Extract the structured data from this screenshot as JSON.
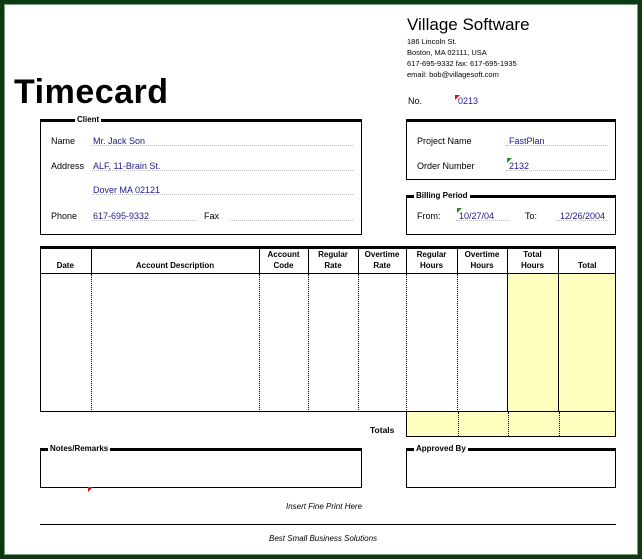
{
  "company": {
    "name": "Village Software",
    "address1": "186 Lincoln St.",
    "address2": "Boston, MA 02111, USA",
    "phone_fax": "617-695-9332 fax: 617-695-1935",
    "email": "email: bob@villagesoft.com"
  },
  "title": "Timecard",
  "number": {
    "label": "No.",
    "value": "0213"
  },
  "client": {
    "section_label": "Client",
    "name_label": "Name",
    "name_value": "Mr. Jack Son",
    "address_label": "Address",
    "address_line1": "ALF, 11-Brain St.",
    "address_line2": "Dover MA 02121",
    "phone_label": "Phone",
    "phone_value": "617-695-9332",
    "fax_label": "Fax",
    "fax_value": ""
  },
  "project": {
    "project_name_label": "Project Name",
    "project_name_value": "FastPlan",
    "order_number_label": "Order Number",
    "order_number_value": "2132"
  },
  "billing": {
    "section_label": "Billing Period",
    "from_label": "From:",
    "from_value": "10/27/04",
    "to_label": "To:",
    "to_value": "12/26/2004"
  },
  "table": {
    "columns": [
      {
        "line1": "",
        "line2": "Date"
      },
      {
        "line1": "",
        "line2": "Account Description"
      },
      {
        "line1": "Account",
        "line2": "Code"
      },
      {
        "line1": "Regular",
        "line2": "Rate"
      },
      {
        "line1": "Overtime",
        "line2": "Rate"
      },
      {
        "line1": "Regular",
        "line2": "Hours"
      },
      {
        "line1": "Overtime",
        "line2": "Hours"
      },
      {
        "line1": "Total",
        "line2": "Hours"
      },
      {
        "line1": "",
        "line2": "Total"
      }
    ],
    "totals_label": "Totals"
  },
  "notes": {
    "label": "Notes/Remarks",
    "value": ""
  },
  "approved": {
    "label": "Approved By",
    "value": ""
  },
  "fine_print": "Insert Fine Print Here",
  "footer": "Best Small Business Solutions",
  "colors": {
    "frame": "#0b3a12",
    "field_text": "#1b1b8a",
    "highlight": "#ffffc0",
    "comment_marker": "#dd1111"
  }
}
